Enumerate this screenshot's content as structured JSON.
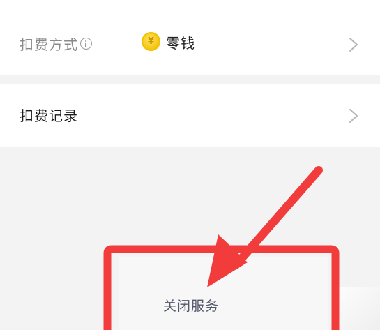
{
  "payment_method": {
    "label": "扣费方式",
    "icon": "info-icon",
    "value": "零钱",
    "value_icon": "coin-icon",
    "coin_symbol": "¥"
  },
  "history": {
    "label": "扣费记录"
  },
  "close_service": {
    "label": "关闭服务"
  },
  "annotation": {
    "color": "#f23c3c",
    "shapes": [
      "highlight-rectangle",
      "pointing-arrow"
    ]
  }
}
